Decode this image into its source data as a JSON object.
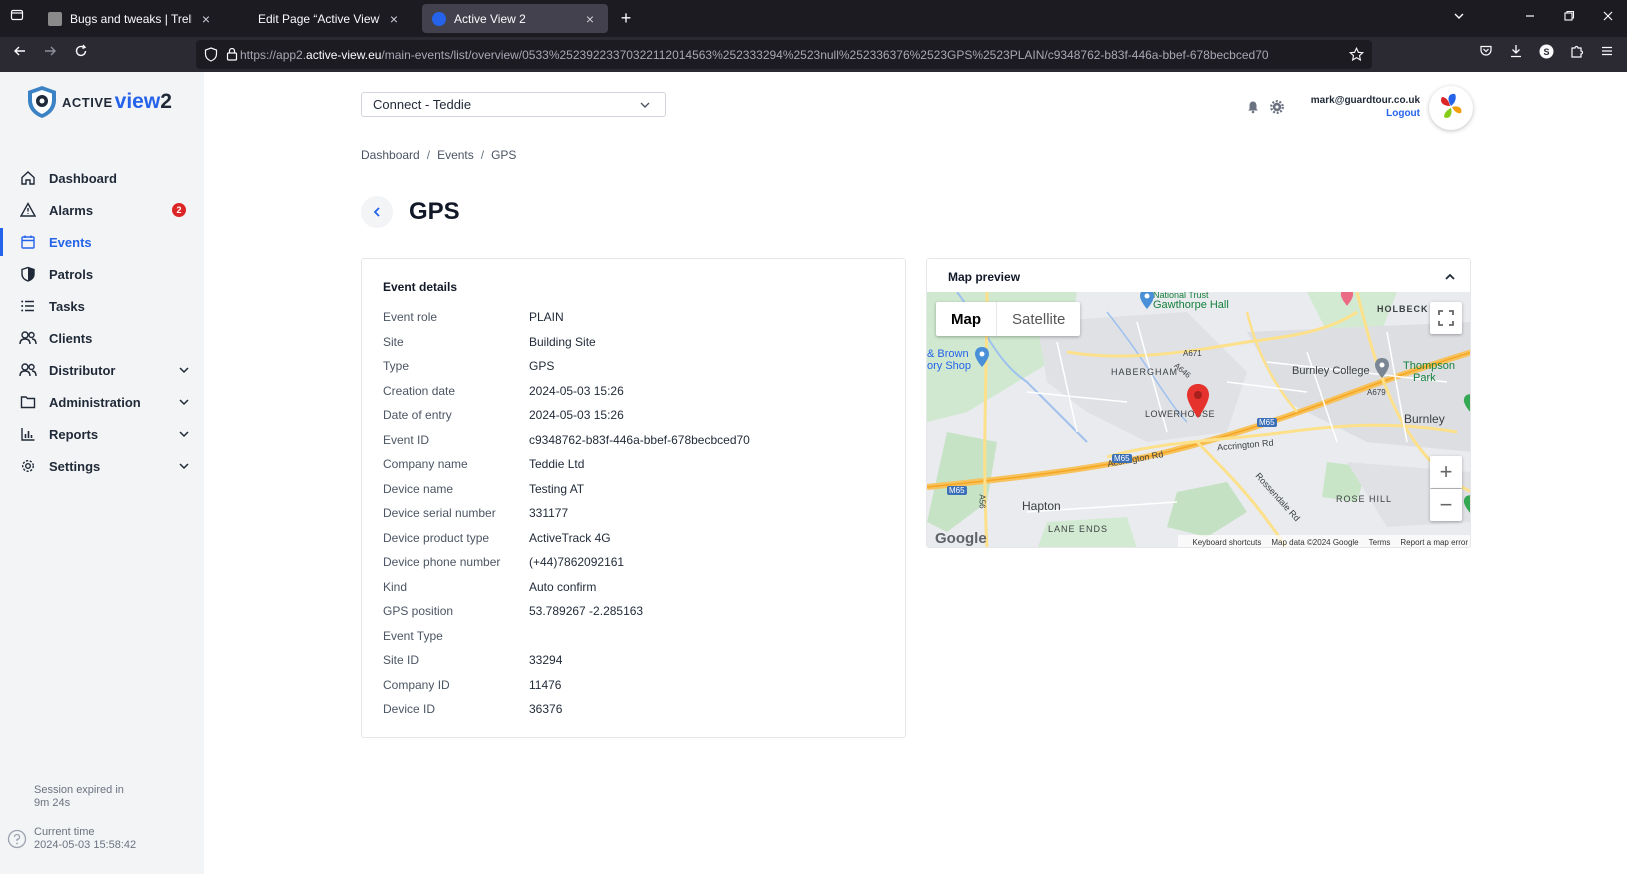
{
  "browser": {
    "tabs": [
      {
        "title": "Bugs and tweaks | Trello",
        "favicon_color": "#8a8a8a"
      },
      {
        "title": "Edit Page “Active View” ‹ Guardtour",
        "favicon_color": "#1c1b22"
      },
      {
        "title": "Active View 2",
        "favicon_color": "#2563eb"
      }
    ],
    "url_prefix": "https://app2.",
    "url_domain": "active-view.eu",
    "url_path": "/main-events/list/overview/0533%2523922337032211201456​3%252333294%2523null%252336376%2523GPS%2523PLAIN/c9348762-b83f-446a-bbef-678becbced70",
    "new_tab": "+",
    "close": "×"
  },
  "logo": {
    "active": "ACTIVE",
    "view": "view",
    "two": "2"
  },
  "sidebar": {
    "items": [
      {
        "label": "Dashboard",
        "icon": "home-icon"
      },
      {
        "label": "Alarms",
        "icon": "warning-icon",
        "badge": "2"
      },
      {
        "label": "Events",
        "icon": "calendar-icon",
        "active": true
      },
      {
        "label": "Patrols",
        "icon": "shield-icon"
      },
      {
        "label": "Tasks",
        "icon": "list-icon"
      },
      {
        "label": "Clients",
        "icon": "users-icon"
      },
      {
        "label": "Distributor",
        "icon": "users-icon",
        "expandable": true
      },
      {
        "label": "Administration",
        "icon": "folder-icon",
        "expandable": true
      },
      {
        "label": "Reports",
        "icon": "bar-chart-icon",
        "expandable": true
      },
      {
        "label": "Settings",
        "icon": "gear-icon",
        "expandable": true
      }
    ],
    "session_line1": "Session expired in",
    "session_line2": "9m 24s",
    "current_time_label": "Current time",
    "current_time_value": "2024-05-03 15:58:42"
  },
  "header": {
    "company_select": "Connect - Teddie",
    "user_email": "mark@guardtour.co.uk",
    "logout": "Logout"
  },
  "breadcrumb": [
    "Dashboard",
    "Events",
    "GPS"
  ],
  "page_title": "GPS",
  "event_details": {
    "title": "Event details",
    "rows": [
      {
        "label": "Event role",
        "value": "PLAIN"
      },
      {
        "label": "Site",
        "value": "Building Site"
      },
      {
        "label": "Type",
        "value": "GPS"
      },
      {
        "label": "Creation date",
        "value": "2024-05-03 15:26"
      },
      {
        "label": "Date of entry",
        "value": "2024-05-03 15:26"
      },
      {
        "label": "Event ID",
        "value": "c9348762-b83f-446a-bbef-678becbced70"
      },
      {
        "label": "Company name",
        "value": "Teddie Ltd"
      },
      {
        "label": "Device name",
        "value": "Testing AT"
      },
      {
        "label": "Device serial number",
        "value": "331177"
      },
      {
        "label": "Device product type",
        "value": "ActiveTrack 4G"
      },
      {
        "label": "Device phone number",
        "value": "(+44)7862092161"
      },
      {
        "label": "Kind",
        "value": "Auto confirm"
      },
      {
        "label": "GPS position",
        "value": "53.789267 -2.285163"
      },
      {
        "label": "Event Type",
        "value": ""
      },
      {
        "label": "Site ID",
        "value": "33294"
      },
      {
        "label": "Company ID",
        "value": "11476"
      },
      {
        "label": "Device ID",
        "value": "36376"
      }
    ]
  },
  "map": {
    "title": "Map preview",
    "type_map": "Map",
    "type_satellite": "Satellite",
    "zoom_in": "+",
    "zoom_out": "−",
    "places": {
      "gawthorpe": "Gawthorpe Hall",
      "national_trust": "National Trust",
      "holbeck": "HOLBECK",
      "habergham": "HABERGHAM",
      "burnley_college": "Burnley College",
      "thompson_park_1": "Thompson",
      "thompson_park_2": "Park",
      "burnley": "Burnley",
      "lowerhouse": "LOWERHOUSE",
      "hapton": "Hapton",
      "lane_ends": "LANE ENDS",
      "rose_hill": "ROSE HILL",
      "brown_1": "& Brown",
      "brown_2": "ory Shop",
      "accrington_rd_1": "Accrington Rd",
      "accrington_rd_2": "Accrington Rd",
      "rossendale_rd": "Rossendale Rd"
    },
    "roads": {
      "m65_a": "M65",
      "m65_b": "M65",
      "m65_c": "M65",
      "a671": "A671",
      "a646": "A646",
      "a679": "A679",
      "a56": "A56"
    },
    "google": "Google",
    "footer": [
      "Keyboard shortcuts",
      "Map data ©2024 Google",
      "Terms",
      "Report a map error"
    ]
  },
  "colors": {
    "accent": "#2563eb",
    "badge": "#dc2626",
    "marker": "#e5322d"
  }
}
